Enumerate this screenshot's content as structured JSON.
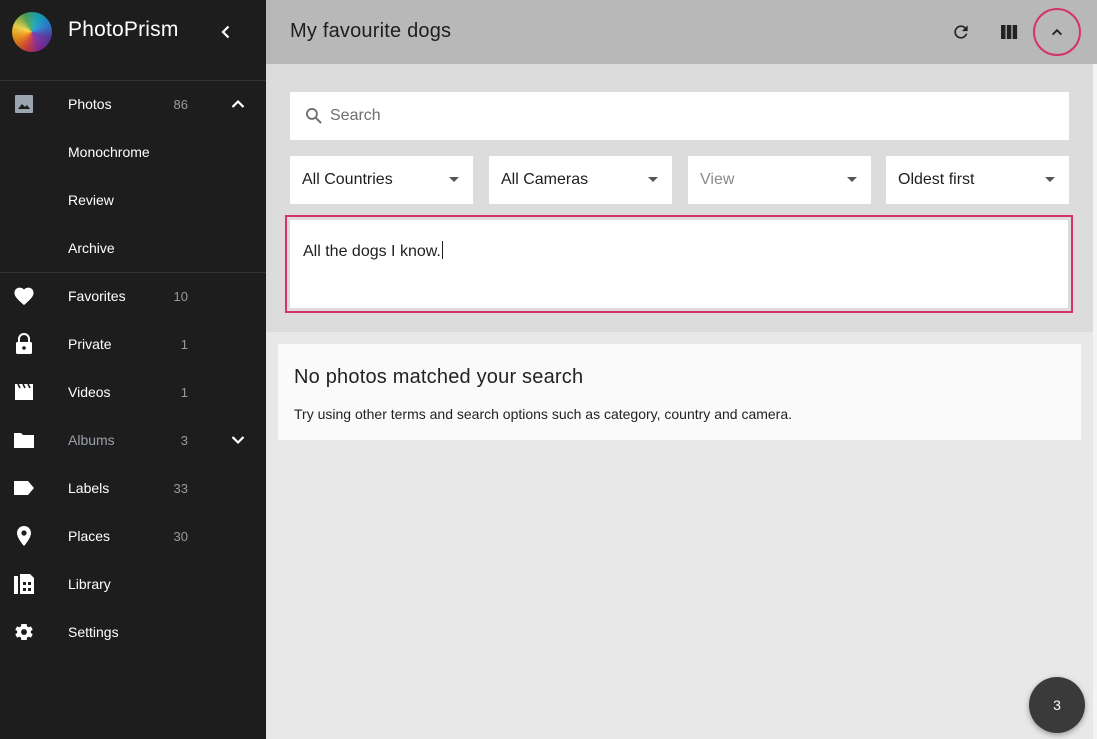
{
  "app": {
    "name": "PhotoPrism"
  },
  "sidebar": {
    "items": [
      {
        "label": "Photos",
        "count": "86",
        "icon": "image-icon",
        "expanded": true
      },
      {
        "label": "Monochrome",
        "count": "",
        "icon": ""
      },
      {
        "label": "Review",
        "count": "",
        "icon": ""
      },
      {
        "label": "Archive",
        "count": "",
        "icon": ""
      },
      {
        "label": "Favorites",
        "count": "10",
        "icon": "heart-icon"
      },
      {
        "label": "Private",
        "count": "1",
        "icon": "lock-icon"
      },
      {
        "label": "Videos",
        "count": "1",
        "icon": "movie-icon"
      },
      {
        "label": "Albums",
        "count": "3",
        "icon": "folder-icon",
        "expanded": false
      },
      {
        "label": "Labels",
        "count": "33",
        "icon": "label-icon"
      },
      {
        "label": "Places",
        "count": "30",
        "icon": "place-icon"
      },
      {
        "label": "Library",
        "count": "",
        "icon": "library-icon"
      },
      {
        "label": "Settings",
        "count": "",
        "icon": "gear-icon"
      }
    ]
  },
  "header": {
    "title": "My favourite dogs",
    "actions": [
      "refresh-icon",
      "view-columns-icon",
      "chevron-up-icon"
    ]
  },
  "filters": {
    "search_placeholder": "Search",
    "country": "All Countries",
    "camera": "All Cameras",
    "view": "View",
    "order": "Oldest first",
    "description": "All the dogs I know."
  },
  "results": {
    "empty_title": "No photos matched your search",
    "empty_text": "Try using other terms and search options such as category, country and camera."
  },
  "fab": {
    "count": "3"
  },
  "colors": {
    "sidebar_bg": "#1d1d1d",
    "header_bg": "#b8b8b8",
    "accent": "#d6336c"
  }
}
